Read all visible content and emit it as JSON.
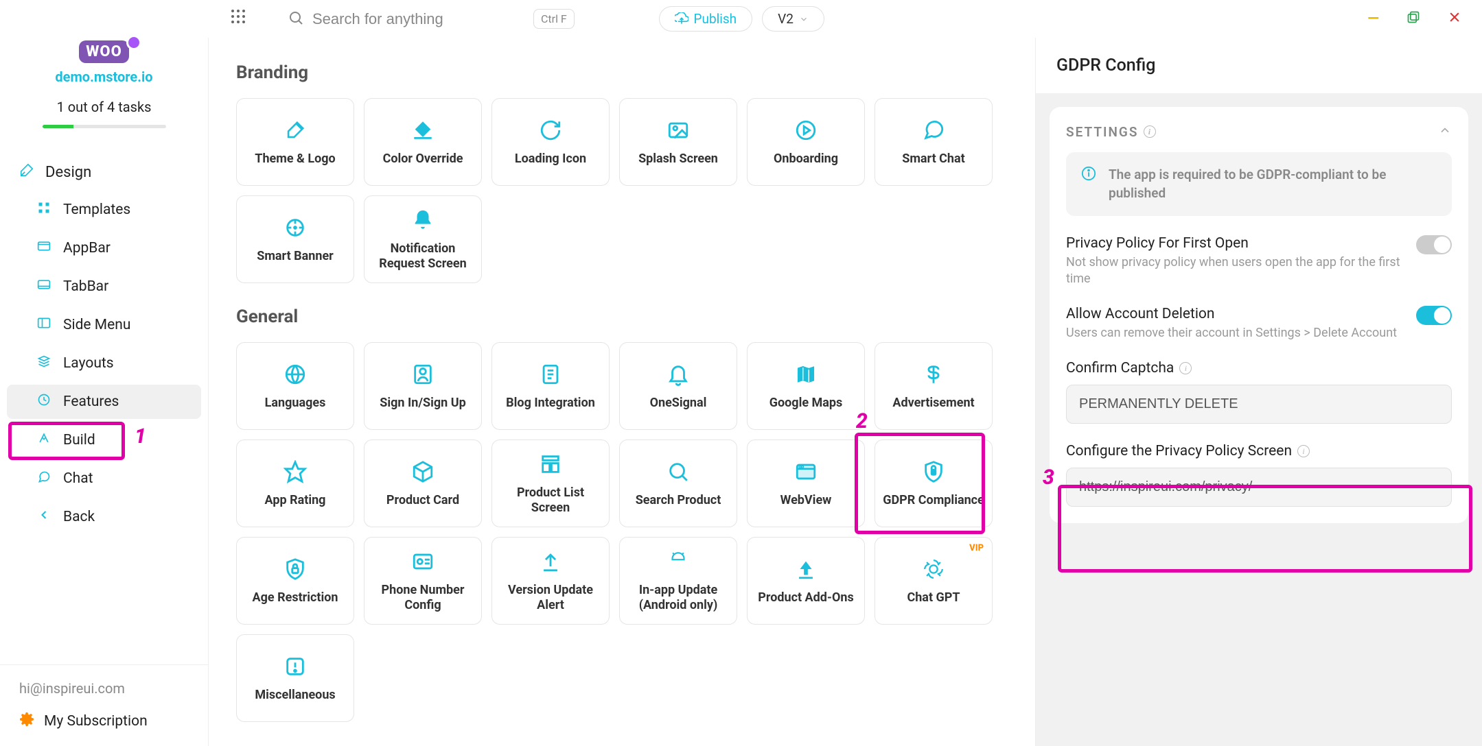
{
  "topbar": {
    "search_placeholder": "Search for anything",
    "shortcut": "Ctrl F",
    "publish_label": "Publish",
    "version_label": "V2"
  },
  "sidebar": {
    "logo_text": "WOO",
    "store": "demo.mstore.io",
    "tasks": "1 out of 4 tasks",
    "progress_percent": 25,
    "design_label": "Design",
    "items": [
      {
        "label": "Templates"
      },
      {
        "label": "AppBar"
      },
      {
        "label": "TabBar"
      },
      {
        "label": "Side Menu"
      },
      {
        "label": "Layouts"
      },
      {
        "label": "Features"
      },
      {
        "label": "Build"
      },
      {
        "label": "Chat"
      },
      {
        "label": "Back"
      }
    ],
    "email": "hi@inspireui.com",
    "subscription": "My Subscription"
  },
  "content": {
    "sections": [
      {
        "title": "Branding",
        "cards": [
          {
            "label": "Theme & Logo",
            "icon": "brush"
          },
          {
            "label": "Color Override",
            "icon": "bucket"
          },
          {
            "label": "Loading Icon",
            "icon": "reload"
          },
          {
            "label": "Splash Screen",
            "icon": "image"
          },
          {
            "label": "Onboarding",
            "icon": "circle-play"
          },
          {
            "label": "Smart Chat",
            "icon": "chat"
          },
          {
            "label": "Smart Banner",
            "icon": "cursor"
          },
          {
            "label": "Notification Request Screen",
            "icon": "bell"
          }
        ]
      },
      {
        "title": "General",
        "cards": [
          {
            "label": "Languages",
            "icon": "globe"
          },
          {
            "label": "Sign In/Sign Up",
            "icon": "user-card"
          },
          {
            "label": "Blog Integration",
            "icon": "doc"
          },
          {
            "label": "OneSignal",
            "icon": "bell-o"
          },
          {
            "label": "Google Maps",
            "icon": "map"
          },
          {
            "label": "Advertisement",
            "icon": "dollar"
          },
          {
            "label": "App Rating",
            "icon": "star"
          },
          {
            "label": "Product Card",
            "icon": "cube"
          },
          {
            "label": "Product List Screen",
            "icon": "list"
          },
          {
            "label": "Search Product",
            "icon": "search"
          },
          {
            "label": "WebView",
            "icon": "browser"
          },
          {
            "label": "GDPR Compliance",
            "icon": "shield"
          },
          {
            "label": "Age Restriction",
            "icon": "lock-shield"
          },
          {
            "label": "Phone Number Config",
            "icon": "contact"
          },
          {
            "label": "Version Update Alert",
            "icon": "upload"
          },
          {
            "label": "In-app Update (Android only)",
            "icon": "android"
          },
          {
            "label": "Product Add-Ons",
            "icon": "add-upload"
          },
          {
            "label": "Chat GPT",
            "icon": "openai",
            "vip": "VIP"
          },
          {
            "label": "Miscellaneous",
            "icon": "warn"
          }
        ]
      }
    ]
  },
  "panel": {
    "title": "GDPR Config",
    "settings_label": "SETTINGS",
    "info": "The app is required to be GDPR-compliant to be published",
    "privacy_first_open": {
      "title": "Privacy Policy For First Open",
      "desc": "Not show privacy policy when users open the app for the first time",
      "value": false
    },
    "allow_deletion": {
      "title": "Allow Account Deletion",
      "desc": "Users can remove their account in Settings > Delete Account",
      "value": true
    },
    "captcha": {
      "label": "Confirm Captcha",
      "value": "PERMANENTLY DELETE"
    },
    "privacy_url": {
      "label": "Configure the Privacy Policy Screen",
      "value": "https://inspireui.com/privacy/"
    }
  },
  "annotations": {
    "n1": "1",
    "n2": "2",
    "n3": "3"
  },
  "colors": {
    "accent": "#1bbfdc",
    "highlight": "#e100a8"
  }
}
